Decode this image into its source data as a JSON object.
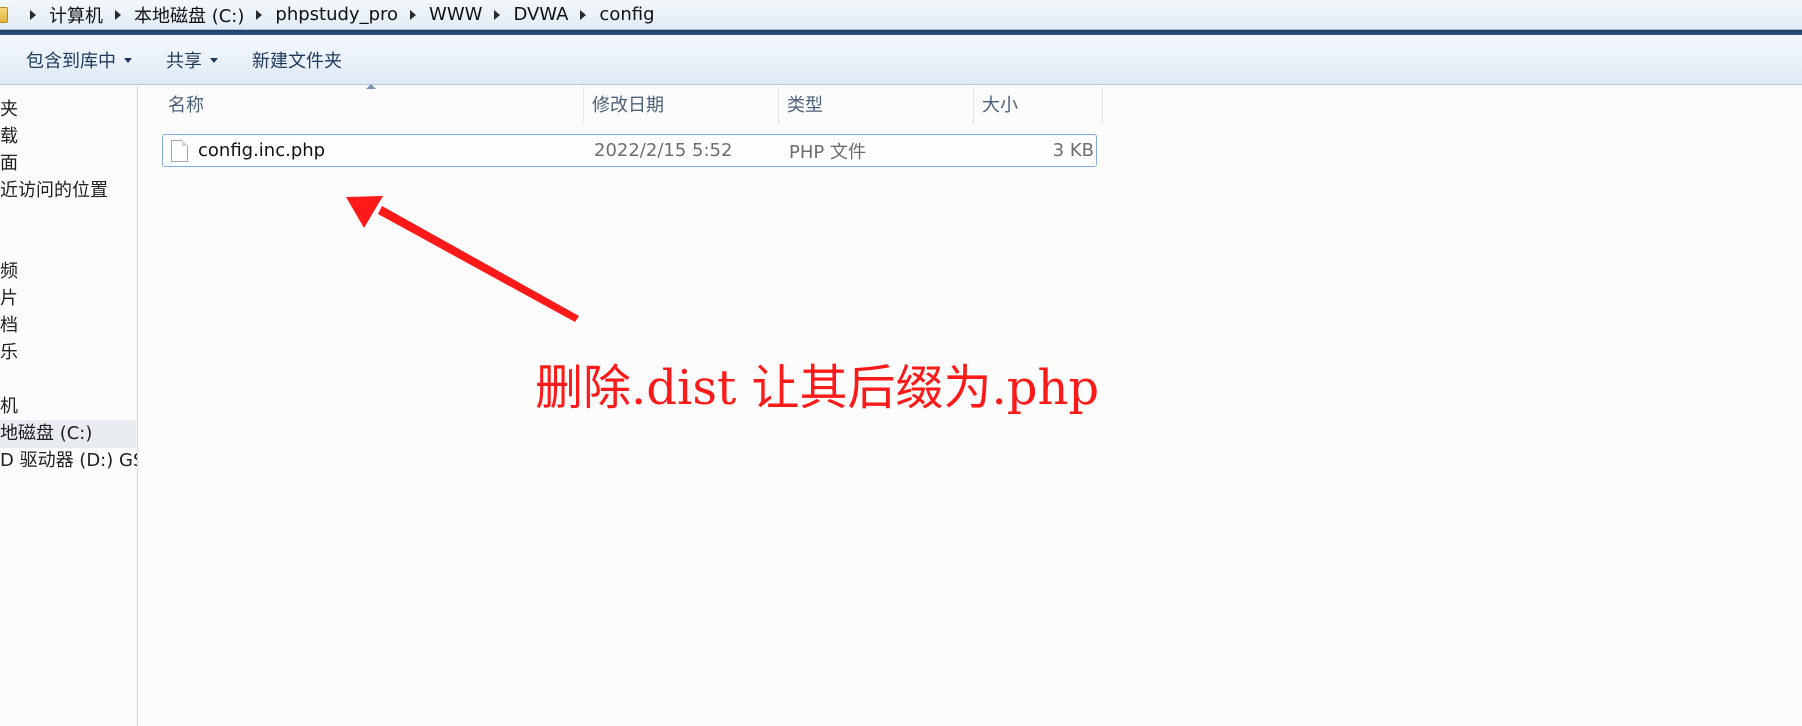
{
  "breadcrumbs": [
    "计算机",
    "本地磁盘 (C:)",
    "phpstudy_pro",
    "WWW",
    "DVWA",
    "config"
  ],
  "toolbar": {
    "include_in_library": "包含到库中",
    "share": "共享",
    "new_folder": "新建文件夹"
  },
  "nav": {
    "items": [
      "夹",
      "载",
      "面",
      "近访问的位置",
      "频",
      "片",
      "档",
      "乐",
      "机",
      "地磁盘 (C:)",
      "D 驱动器 (D:) GSP"
    ],
    "selected_index": 9
  },
  "columns": {
    "name": "名称",
    "date": "修改日期",
    "type": "类型",
    "size": "大小"
  },
  "files": [
    {
      "name": "config.inc.php",
      "date": "2022/2/15 5:52",
      "type": "PHP 文件",
      "size": "3 KB",
      "icon": "document-icon"
    }
  ],
  "annotation": {
    "text": "删除.dist 让其后缀为.php",
    "color": "#ff1a1a"
  },
  "colors": {
    "selection_border": "#84acdd",
    "toolbar_text": "#1e395b",
    "header_text": "#4c607a"
  }
}
